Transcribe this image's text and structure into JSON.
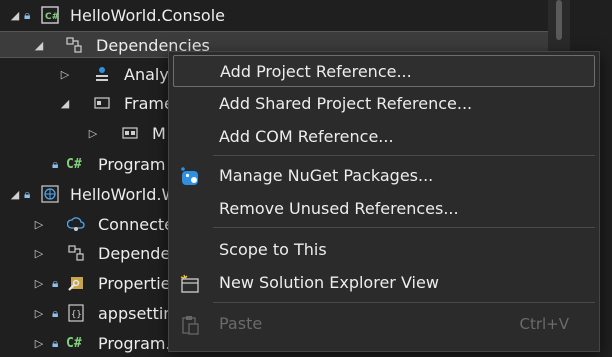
{
  "tree": {
    "items": [
      {
        "label": "HelloWorld.Console"
      },
      {
        "label": "Dependencies"
      },
      {
        "label": "Analy"
      },
      {
        "label": "Frame"
      },
      {
        "label": "M"
      },
      {
        "label": "Program"
      },
      {
        "label": "HelloWorld.W"
      },
      {
        "label": "Connecte"
      },
      {
        "label": "Depende"
      },
      {
        "label": "Propertie"
      },
      {
        "label": "appsettin"
      },
      {
        "label": "Program.cs"
      }
    ],
    "cs_badge": "C#"
  },
  "menu": {
    "items": [
      {
        "label": "Add Project Reference...",
        "icon": ""
      },
      {
        "label": "Add Shared Project Reference...",
        "icon": ""
      },
      {
        "label": "Add COM Reference...",
        "icon": ""
      },
      {
        "label": "Manage NuGet Packages...",
        "icon": "nuget-icon"
      },
      {
        "label": "Remove Unused References...",
        "icon": ""
      },
      {
        "label": "Scope to This",
        "icon": ""
      },
      {
        "label": "New Solution Explorer View",
        "icon": "new-explorer-view-icon"
      },
      {
        "label": "Paste",
        "icon": "paste-icon",
        "shortcut": "Ctrl+V",
        "disabled": true
      }
    ]
  },
  "colors": {
    "background": "#1f1f1f",
    "menu_background": "#2b2b2b",
    "selected_row": "#3c3c3c",
    "csharp_green": "#7fd47a",
    "nuget_blue": "#2f8fe0"
  }
}
